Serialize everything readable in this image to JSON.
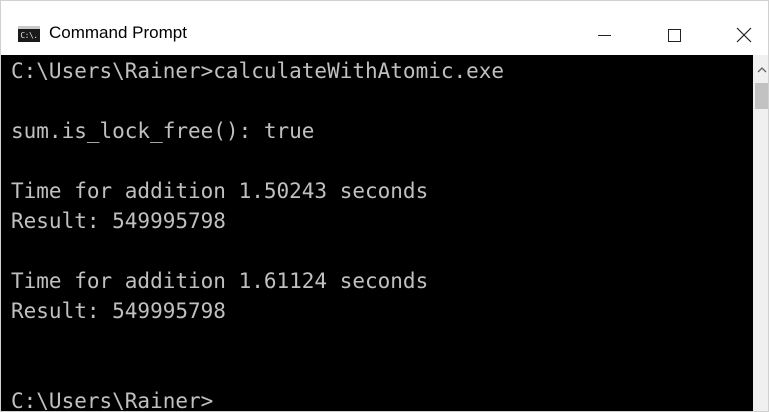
{
  "window": {
    "title": "Command Prompt",
    "icon": "cmd-icon",
    "icon_text": "C:\\."
  },
  "controls": {
    "minimize": "minimize-icon",
    "maximize": "maximize-icon",
    "close": "close-icon"
  },
  "console": {
    "lines": [
      "C:\\Users\\Rainer>calculateWithAtomic.exe",
      "",
      "sum.is_lock_free(): true",
      "",
      "Time for addition 1.50243 seconds",
      "Result: 549995798",
      "",
      "Time for addition 1.61124 seconds",
      "Result: 549995798",
      "",
      "",
      "C:\\Users\\Rainer>"
    ]
  },
  "colors": {
    "console_bg": "#000000",
    "console_text": "#c0c0c0",
    "titlebar_bg": "#ffffff"
  }
}
